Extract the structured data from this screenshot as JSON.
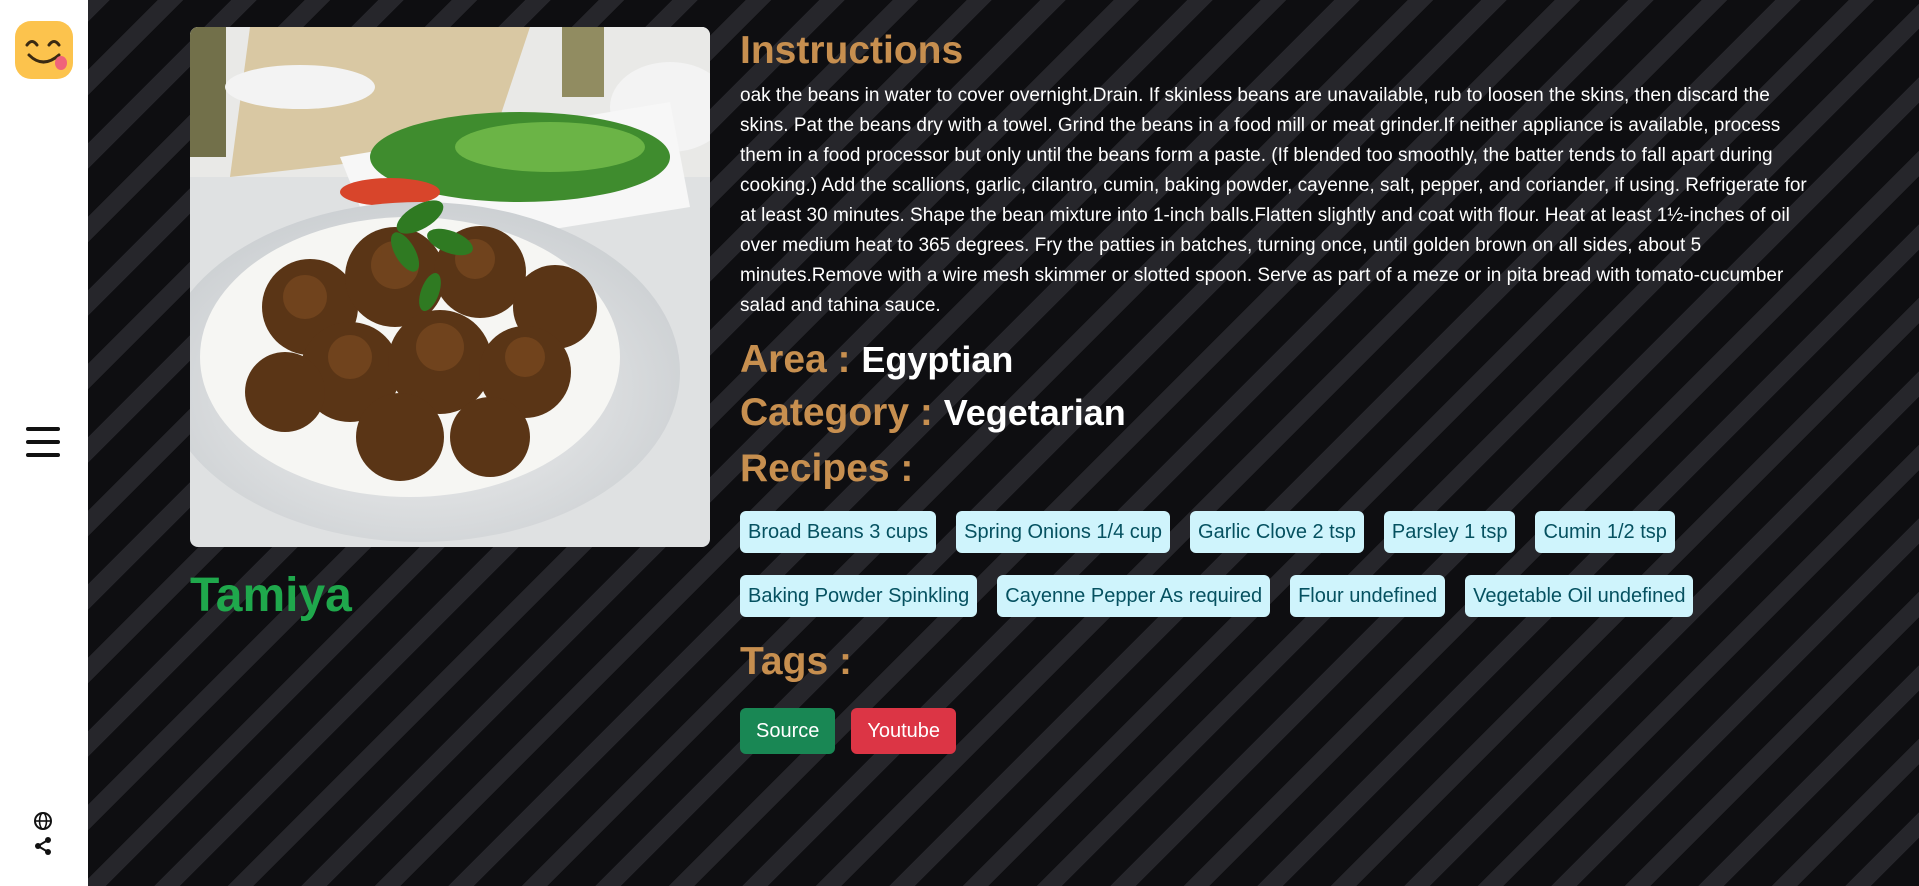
{
  "meal": {
    "name": "Tamiya",
    "image_alt": "Tamiya"
  },
  "instructions": {
    "heading": "Instructions",
    "text": "oak the beans in water to cover overnight.Drain. If skinless beans are unavailable, rub to loosen the skins, then discard the skins. Pat the beans dry with a towel. Grind the beans in a food mill or meat grinder.If neither appliance is available, process them in a food processor but only until the beans form a paste. (If blended too smoothly, the batter tends to fall apart during cooking.) Add the scallions, garlic, cilantro, cumin, baking powder, cayenne, salt, pepper, and coriander, if using. Refrigerate for at least 30 minutes. Shape the bean mixture into 1-inch balls.Flatten slightly and coat with flour. Heat at least 1½-inches of oil over medium heat to 365 degrees. Fry the patties in batches, turning once, until golden brown on all sides, about 5 minutes.Remove with a wire mesh skimmer or slotted spoon. Serve as part of a meze or in pita bread with tomato-cucumber salad and tahina sauce."
  },
  "area": {
    "label": "Area : ",
    "value": "Egyptian"
  },
  "category": {
    "label": "Category : ",
    "value": "Vegetarian"
  },
  "recipes": {
    "heading": "Recipes :",
    "items": [
      "Broad Beans 3 cups",
      "Spring Onions 1/4 cup",
      "Garlic Clove 2 tsp",
      "Parsley 1 tsp",
      "Cumin 1/2 tsp",
      "Baking Powder Spinkling",
      "Cayenne Pepper As required",
      "Flour undefined",
      "Vegetable Oil undefined"
    ]
  },
  "tags": {
    "heading": "Tags :",
    "source_label": "Source",
    "youtube_label": "Youtube"
  },
  "sidebar": {
    "logo_icon": "smiling-face-logo",
    "menu_icon": "hamburger-menu-icon",
    "globe_icon": "globe-icon",
    "share_icon": "share-icon"
  },
  "colors": {
    "title_green": "#1fa84c",
    "heading_gold": "#c78f4f",
    "chip_bg": "#cff4fc",
    "source_btn": "#198754",
    "youtube_btn": "#dc3545"
  }
}
